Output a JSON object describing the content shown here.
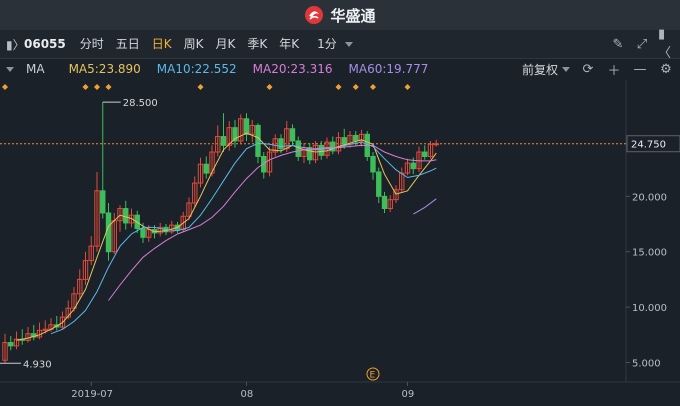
{
  "app": {
    "logo_text": "华盛通"
  },
  "toolbar": {
    "symbol": "06055",
    "periods": [
      "分时",
      "五日",
      "日K",
      "周K",
      "月K",
      "季K",
      "年K"
    ],
    "active_period": "日K",
    "minute_select": "1分"
  },
  "indicators": {
    "label": "MA",
    "ma5": "MA5:23.890",
    "ma10": "MA10:22.552",
    "ma20": "MA20:23.316",
    "ma60": "MA60:19.777",
    "adjust": "前复权"
  },
  "colors": {
    "up": "#e04b3a",
    "down": "#3dbe5a",
    "ma5": "#e6c35c",
    "ma10": "#5cb8e6",
    "ma20": "#d97ed6",
    "ma60": "#a58ee8",
    "current_price": "#f08a3a"
  },
  "chart_data": {
    "type": "candlestick",
    "y_ticks": [
      "20.000",
      "15.000",
      "10.000",
      "5.000"
    ],
    "y_tick_values": [
      20,
      15,
      10,
      5
    ],
    "ylim": [
      3.6,
      29.6
    ],
    "x_ticks": [
      "2019-07",
      "08",
      "09"
    ],
    "x_tick_index": [
      15,
      42,
      70
    ],
    "current_price": "24.750",
    "current_price_value": 24.75,
    "high_label": "28.500",
    "high_value": 28.5,
    "high_index": 17,
    "low_label": "4.930",
    "low_value": 4.93,
    "low_index": 0,
    "event_marker": "E",
    "event_index": 64,
    "dividend_marker_index": [
      0,
      14,
      16,
      18,
      34,
      46,
      58,
      61,
      64,
      70
    ],
    "candles": [
      [
        5.2,
        6.8,
        7.6,
        4.93
      ],
      [
        6.8,
        6.5,
        7.4,
        6.1
      ],
      [
        6.5,
        7.1,
        7.8,
        6.2
      ],
      [
        7.1,
        7.0,
        8.0,
        6.6
      ],
      [
        7.0,
        7.6,
        8.2,
        6.8
      ],
      [
        7.6,
        7.3,
        8.4,
        7.0
      ],
      [
        7.3,
        7.9,
        8.6,
        7.1
      ],
      [
        7.9,
        8.0,
        8.8,
        7.6
      ],
      [
        8.0,
        8.4,
        9.0,
        7.8
      ],
      [
        8.4,
        8.2,
        9.2,
        7.9
      ],
      [
        8.2,
        9.1,
        9.6,
        8.0
      ],
      [
        9.1,
        9.9,
        10.6,
        8.9
      ],
      [
        9.9,
        11.2,
        11.8,
        9.6
      ],
      [
        11.2,
        12.5,
        13.4,
        10.8
      ],
      [
        12.5,
        14.2,
        15.0,
        12.0
      ],
      [
        14.2,
        15.5,
        16.4,
        13.8
      ],
      [
        15.5,
        20.5,
        22.2,
        15.0
      ],
      [
        20.5,
        18.5,
        28.5,
        18.0
      ],
      [
        18.5,
        15.0,
        19.4,
        14.2
      ],
      [
        15.0,
        17.8,
        18.5,
        14.8
      ],
      [
        17.8,
        18.9,
        19.2,
        16.8
      ],
      [
        18.9,
        17.6,
        19.6,
        17.0
      ],
      [
        17.6,
        18.3,
        18.9,
        17.2
      ],
      [
        18.3,
        17.1,
        18.7,
        16.7
      ],
      [
        17.1,
        16.3,
        17.6,
        15.8
      ],
      [
        16.3,
        17.0,
        17.4,
        15.9
      ],
      [
        17.0,
        16.7,
        17.4,
        16.2
      ],
      [
        16.7,
        17.2,
        17.6,
        16.4
      ],
      [
        17.2,
        16.8,
        17.5,
        16.5
      ],
      [
        16.8,
        17.4,
        17.8,
        16.6
      ],
      [
        17.4,
        17.0,
        17.7,
        16.7
      ],
      [
        17.0,
        18.2,
        18.6,
        16.8
      ],
      [
        18.2,
        19.4,
        19.9,
        17.9
      ],
      [
        19.4,
        21.2,
        21.8,
        19.0
      ],
      [
        21.2,
        22.9,
        23.5,
        20.8
      ],
      [
        22.9,
        22.1,
        23.6,
        21.6
      ],
      [
        22.1,
        24.0,
        24.6,
        21.8
      ],
      [
        24.0,
        25.4,
        26.4,
        23.6
      ],
      [
        25.4,
        24.6,
        27.5,
        24.0
      ],
      [
        24.6,
        26.2,
        26.8,
        24.1
      ],
      [
        26.2,
        25.0,
        26.9,
        24.4
      ],
      [
        25.0,
        27.0,
        27.4,
        24.8
      ],
      [
        27.0,
        25.6,
        27.5,
        25.0
      ],
      [
        25.6,
        26.4,
        26.9,
        24.9
      ],
      [
        26.4,
        23.6,
        26.6,
        23.0
      ],
      [
        23.6,
        22.2,
        24.0,
        21.6
      ],
      [
        22.2,
        24.0,
        24.5,
        21.8
      ],
      [
        24.0,
        25.2,
        25.6,
        23.6
      ],
      [
        25.2,
        24.3,
        25.6,
        23.9
      ],
      [
        24.3,
        26.1,
        26.8,
        24.0
      ],
      [
        26.1,
        25.0,
        26.5,
        24.6
      ],
      [
        25.0,
        23.6,
        25.4,
        23.2
      ],
      [
        23.6,
        24.4,
        24.8,
        23.0
      ],
      [
        24.4,
        23.3,
        24.8,
        22.9
      ],
      [
        23.3,
        24.6,
        25.0,
        23.0
      ],
      [
        24.6,
        23.7,
        25.0,
        23.3
      ],
      [
        23.7,
        24.9,
        25.3,
        23.4
      ],
      [
        24.9,
        24.1,
        25.4,
        23.8
      ],
      [
        24.1,
        25.3,
        25.8,
        23.8
      ],
      [
        25.3,
        24.7,
        26.1,
        24.3
      ],
      [
        24.7,
        25.5,
        25.9,
        24.4
      ],
      [
        25.5,
        25.0,
        25.9,
        24.6
      ],
      [
        25.0,
        25.6,
        26.0,
        24.5
      ],
      [
        25.6,
        23.6,
        25.9,
        23.2
      ],
      [
        23.6,
        22.2,
        24.0,
        21.5
      ],
      [
        22.2,
        20.0,
        22.6,
        19.4
      ],
      [
        20.0,
        18.9,
        20.4,
        18.5
      ],
      [
        18.9,
        19.7,
        20.1,
        18.6
      ],
      [
        19.7,
        20.6,
        21.0,
        19.4
      ],
      [
        20.6,
        22.1,
        22.6,
        20.3
      ],
      [
        22.1,
        23.0,
        23.4,
        21.9
      ],
      [
        23.0,
        22.5,
        23.5,
        22.0
      ],
      [
        22.5,
        24.0,
        24.5,
        22.2
      ],
      [
        24.0,
        23.6,
        24.6,
        23.3
      ],
      [
        23.6,
        24.7,
        25.0,
        23.4
      ],
      [
        24.7,
        24.75,
        25.1,
        24.5
      ]
    ],
    "ma_lines": {
      "ma5": [
        [
          2,
          7.0
        ],
        [
          4,
          7.2
        ],
        [
          6,
          7.5
        ],
        [
          8,
          8.0
        ],
        [
          10,
          8.6
        ],
        [
          12,
          9.8
        ],
        [
          14,
          11.6
        ],
        [
          16,
          14.5
        ],
        [
          18,
          17.3
        ],
        [
          20,
          18.3
        ],
        [
          22,
          18.0
        ],
        [
          24,
          17.3
        ],
        [
          26,
          16.8
        ],
        [
          28,
          16.9
        ],
        [
          30,
          17.2
        ],
        [
          32,
          18.0
        ],
        [
          34,
          20.0
        ],
        [
          36,
          22.2
        ],
        [
          38,
          24.2
        ],
        [
          40,
          25.2
        ],
        [
          42,
          25.7
        ],
        [
          44,
          25.3
        ],
        [
          46,
          24.2
        ],
        [
          48,
          24.1
        ],
        [
          50,
          24.6
        ],
        [
          52,
          24.2
        ],
        [
          54,
          24.0
        ],
        [
          56,
          24.1
        ],
        [
          58,
          24.5
        ],
        [
          60,
          24.8
        ],
        [
          62,
          25.1
        ],
        [
          64,
          24.7
        ],
        [
          66,
          22.0
        ],
        [
          68,
          20.2
        ],
        [
          70,
          20.5
        ],
        [
          72,
          21.9
        ],
        [
          74,
          23.2
        ],
        [
          75,
          23.9
        ]
      ],
      "ma10": [
        [
          8,
          7.6
        ],
        [
          10,
          8.0
        ],
        [
          12,
          8.7
        ],
        [
          14,
          9.7
        ],
        [
          16,
          11.4
        ],
        [
          18,
          13.6
        ],
        [
          20,
          15.5
        ],
        [
          22,
          16.6
        ],
        [
          24,
          17.2
        ],
        [
          26,
          17.2
        ],
        [
          28,
          17.0
        ],
        [
          30,
          16.9
        ],
        [
          32,
          17.2
        ],
        [
          34,
          18.3
        ],
        [
          36,
          19.8
        ],
        [
          38,
          21.4
        ],
        [
          40,
          23.0
        ],
        [
          42,
          24.3
        ],
        [
          44,
          24.8
        ],
        [
          46,
          24.7
        ],
        [
          48,
          24.5
        ],
        [
          50,
          24.6
        ],
        [
          52,
          24.4
        ],
        [
          54,
          24.2
        ],
        [
          56,
          24.3
        ],
        [
          58,
          24.4
        ],
        [
          60,
          24.7
        ],
        [
          62,
          24.9
        ],
        [
          64,
          24.5
        ],
        [
          66,
          23.4
        ],
        [
          68,
          22.4
        ],
        [
          70,
          21.7
        ],
        [
          72,
          21.9
        ],
        [
          74,
          22.3
        ],
        [
          75,
          22.55
        ]
      ],
      "ma20": [
        [
          18,
          10.6
        ],
        [
          20,
          12.0
        ],
        [
          22,
          13.3
        ],
        [
          24,
          14.5
        ],
        [
          26,
          15.3
        ],
        [
          28,
          16.0
        ],
        [
          30,
          16.6
        ],
        [
          32,
          17.0
        ],
        [
          34,
          17.4
        ],
        [
          36,
          18.1
        ],
        [
          38,
          19.1
        ],
        [
          40,
          20.4
        ],
        [
          42,
          21.6
        ],
        [
          44,
          22.6
        ],
        [
          46,
          23.3
        ],
        [
          48,
          23.7
        ],
        [
          50,
          24.0
        ],
        [
          52,
          24.2
        ],
        [
          54,
          24.3
        ],
        [
          56,
          24.4
        ],
        [
          58,
          24.4
        ],
        [
          60,
          24.5
        ],
        [
          62,
          24.6
        ],
        [
          64,
          24.6
        ],
        [
          66,
          24.0
        ],
        [
          68,
          23.6
        ],
        [
          70,
          23.3
        ],
        [
          72,
          23.2
        ],
        [
          74,
          23.2
        ],
        [
          75,
          23.3
        ]
      ],
      "ma60": [
        [
          71,
          18.4
        ],
        [
          73,
          19.0
        ],
        [
          75,
          19.78
        ]
      ]
    }
  }
}
